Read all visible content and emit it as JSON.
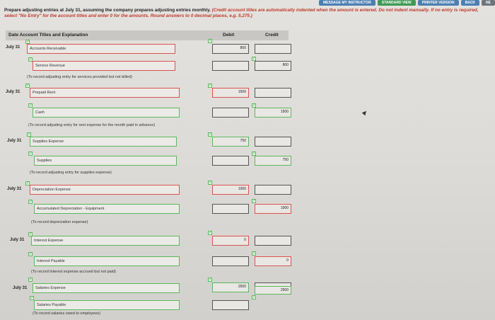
{
  "nav": {
    "message": "MESSAGE MY INSTRUCTOR",
    "standard": "STANDARD VIEW",
    "printer": "PRINTER VERSION",
    "back": "BACK",
    "next": "NE"
  },
  "instructions": {
    "main": "Prepare adjusting entries at July 31, assuming the company prepares adjusting entries monthly.",
    "red": "(Credit account titles are automatically indented when the amount is entered. Do not indent manually. If no entry is required, select \"No Entry\" for the account titles and enter 0 for the amounts. Round answers to 0 decimal places, e.g. 5,275.)"
  },
  "table": {
    "col_date": "Date  Account Titles and Explanation",
    "col_debit": "Debit",
    "col_credit": "Credit"
  },
  "entries": [
    {
      "date": "July 31",
      "debit_account": "Accounts Receivable",
      "debit": "800",
      "credit_account": "Service Revenue",
      "credit": "800",
      "note": "(To record adjusting entry for services provided but not billed)"
    },
    {
      "date": "July 31",
      "debit_account": "Prepaid Rent",
      "debit": "1500",
      "credit_account": "Cash",
      "credit": "1500",
      "note": "(To record adjusting entry for rent expense for the month paid in advance)"
    },
    {
      "date": "July 31",
      "debit_account": "Supplies Expense",
      "debit": "750",
      "credit_account": "Supplies",
      "credit": "750",
      "note": "(To record adjusting entry for supplies expense)"
    },
    {
      "date": "July 31",
      "debit_account": "Depreciation Expense",
      "debit": "1000",
      "credit_account": "Accumulated Depreciation - Equipment",
      "credit": "1000",
      "note": "(To record depreciation expense)"
    },
    {
      "date": "July 31",
      "debit_account": "Interest Expense",
      "debit": "0",
      "credit_account": "Interest Payable",
      "credit": "0",
      "note": "(To record interest expense accrued but not paid)"
    },
    {
      "date": "July 31",
      "debit_account": "Salaries Expense",
      "debit": "2500",
      "credit_account": "Salaries Payable",
      "credit": "2500",
      "note": "(To record salaries owed to employees)"
    }
  ]
}
